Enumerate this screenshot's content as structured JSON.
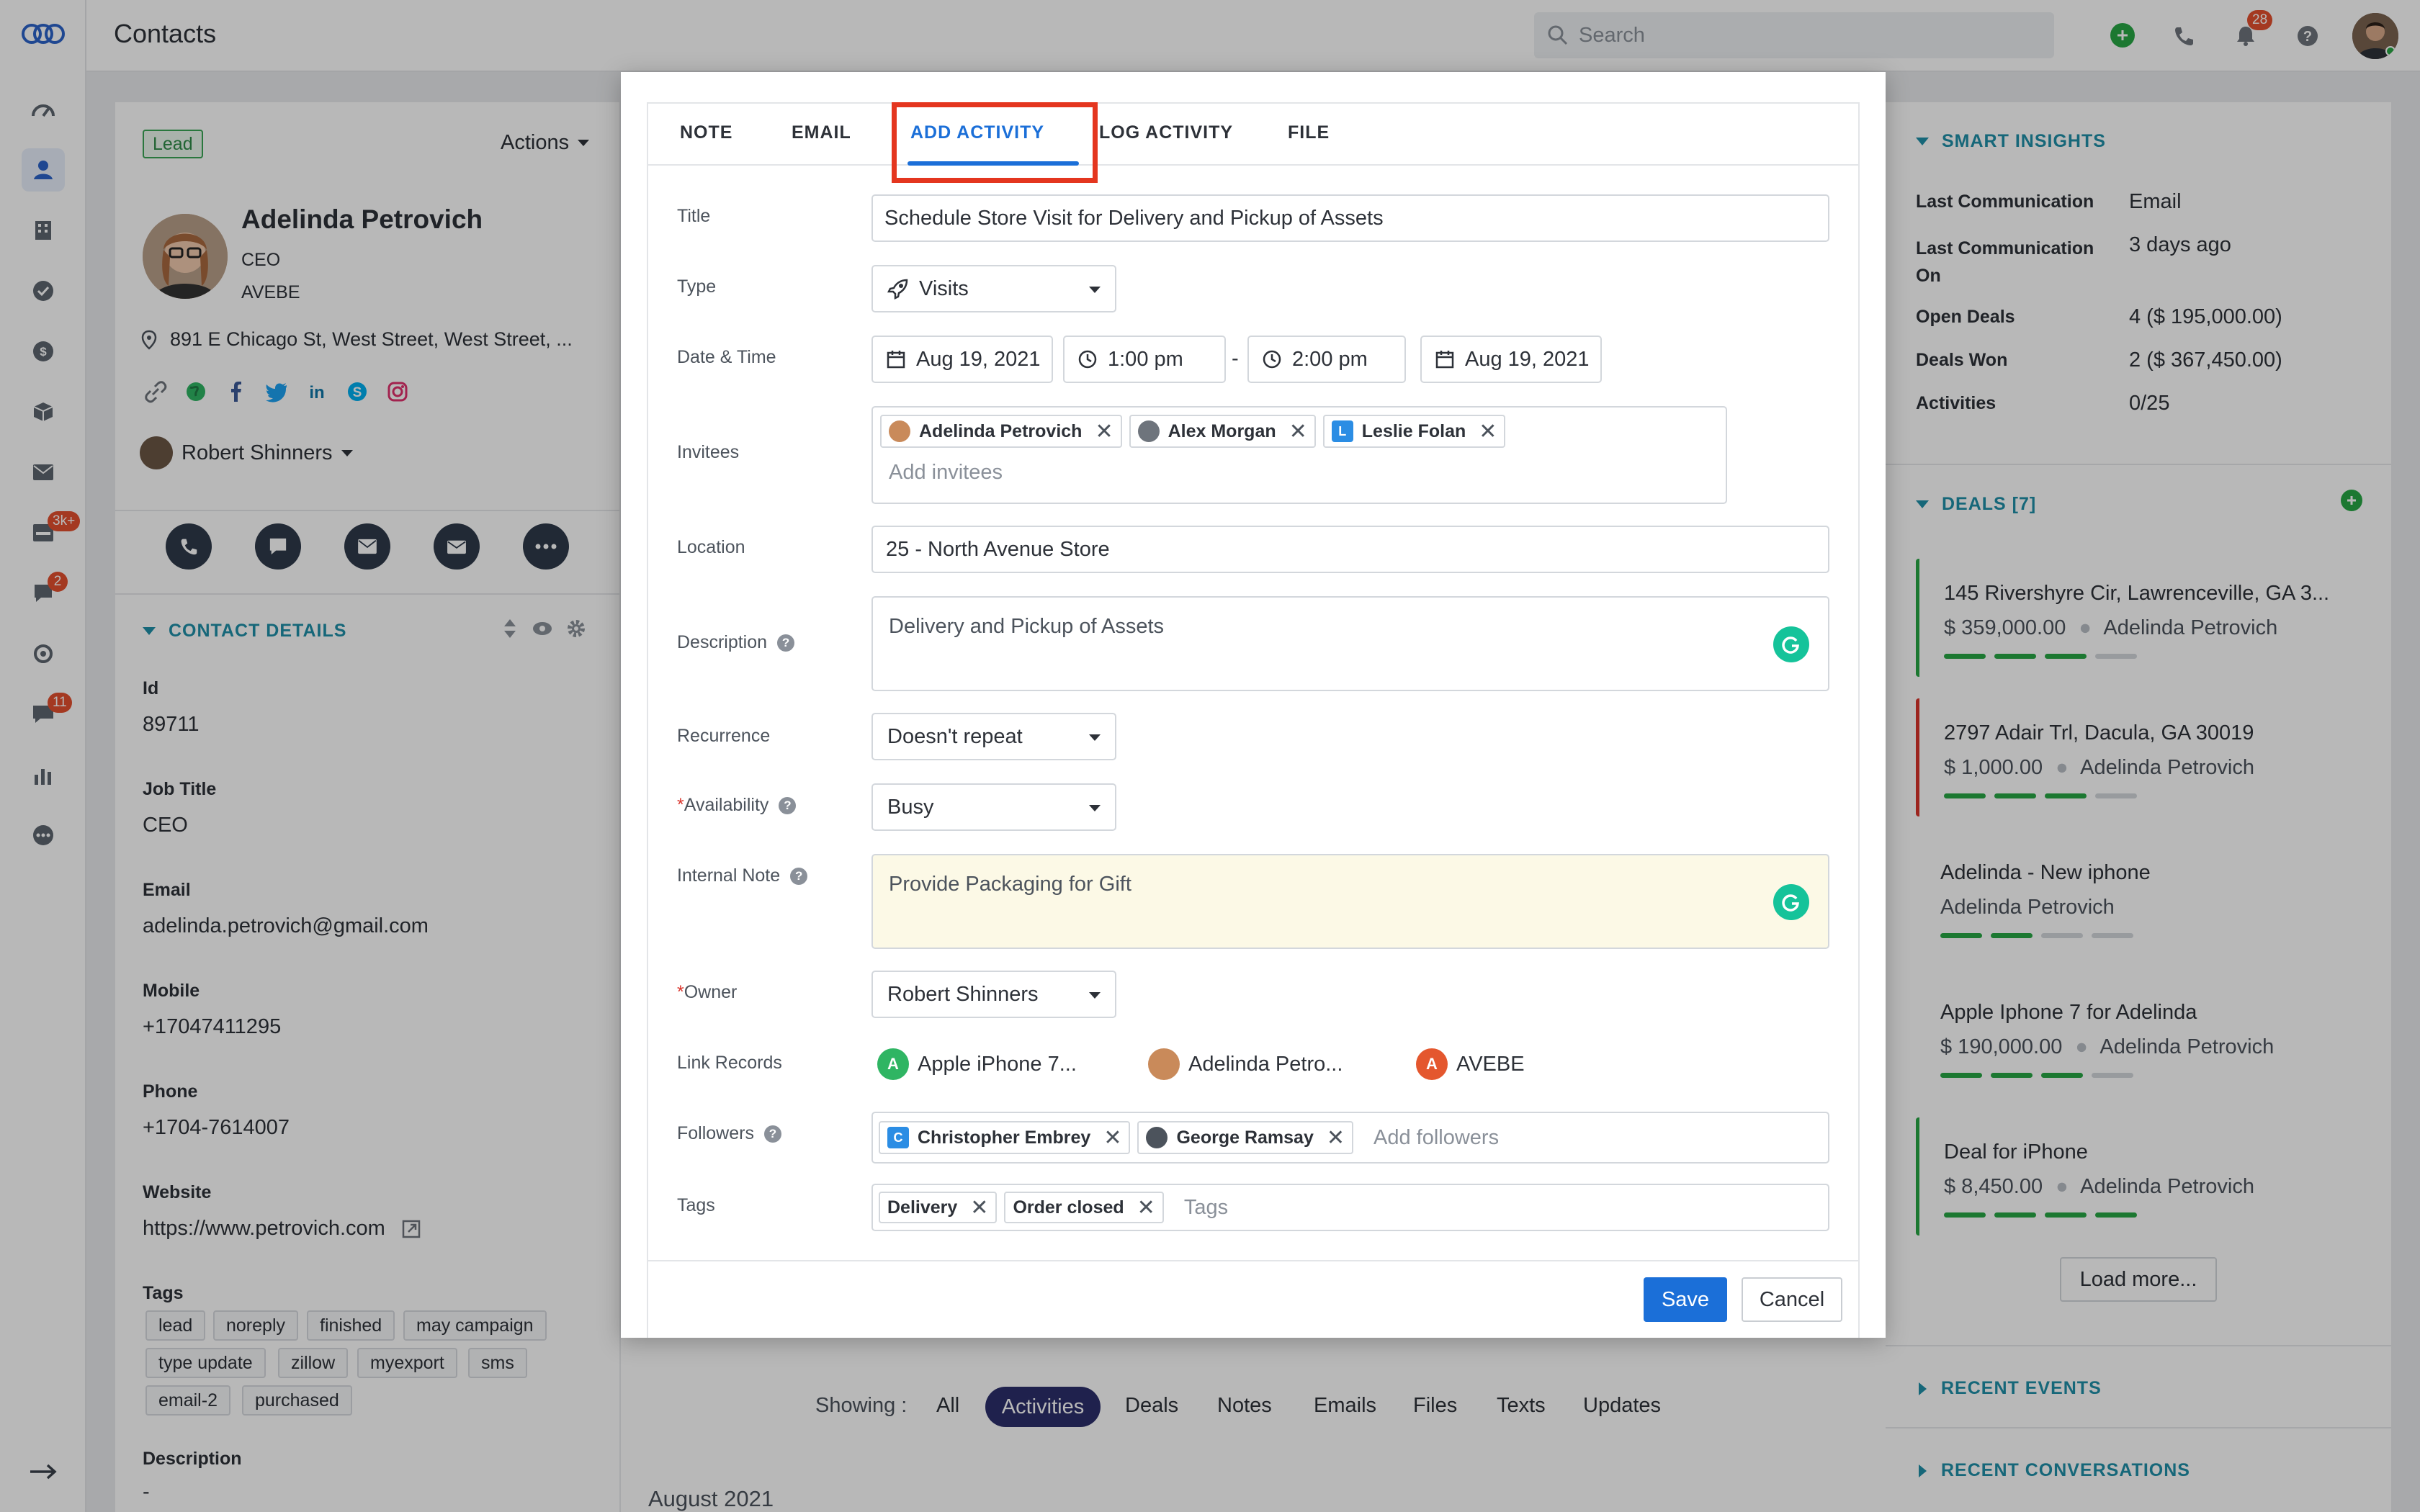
{
  "app": {
    "page_title": "Contacts"
  },
  "topbar": {
    "search_placeholder": "Search",
    "notification_count": "28"
  },
  "rail": {
    "badges": {
      "inbox": "3k+",
      "chat": "2",
      "messages": "11"
    }
  },
  "contact": {
    "lead_badge": "Lead",
    "actions_label": "Actions",
    "name": "Adelinda Petrovich",
    "title": "CEO",
    "company": "AVEBE",
    "address": "891 E Chicago St, West Street, West Street, ...",
    "owner": "Robert Shinners",
    "details_header": "CONTACT DETAILS",
    "fields": [
      {
        "label": "Id",
        "value": "89711"
      },
      {
        "label": "Job Title",
        "value": "CEO"
      },
      {
        "label": "Email",
        "value": "adelinda.petrovich@gmail.com"
      },
      {
        "label": "Mobile",
        "value": "+17047411295"
      },
      {
        "label": "Phone",
        "value": "+1704-7614007"
      },
      {
        "label": "Website",
        "value": "https://www.petrovich.com"
      }
    ],
    "tags_label": "Tags",
    "tags": [
      "lead",
      "noreply",
      "finished",
      "may campaign",
      "type update",
      "zillow",
      "myexport",
      "sms",
      "email-2",
      "purchased"
    ],
    "description_label": "Description",
    "description_value": "-"
  },
  "modal": {
    "tabs": [
      "NOTE",
      "EMAIL",
      "ADD ACTIVITY",
      "LOG ACTIVITY",
      "FILE"
    ],
    "active_tab": "ADD ACTIVITY",
    "labels": {
      "title": "Title",
      "type": "Type",
      "datetime": "Date & Time",
      "invitees": "Invitees",
      "location": "Location",
      "description": "Description",
      "recurrence": "Recurrence",
      "availability": "Availability",
      "internal_note": "Internal Note",
      "owner": "Owner",
      "link_records": "Link Records",
      "followers": "Followers",
      "tags": "Tags"
    },
    "title_value": "Schedule Store Visit for Delivery and Pickup of Assets",
    "type_value": "Visits",
    "start_date": "Aug 19, 2021",
    "start_time": "1:00 pm",
    "separator": "-",
    "end_time": "2:00 pm",
    "end_date": "Aug 19, 2021",
    "invitees": [
      {
        "name": "Adelinda Petrovich",
        "avatar": "photo"
      },
      {
        "name": "Alex Morgan",
        "avatar": "photo"
      },
      {
        "name": "Leslie Folan",
        "avatar": "L"
      }
    ],
    "invitees_placeholder": "Add invitees",
    "location_value": "25 - North Avenue Store",
    "description_value": "Delivery and Pickup of Assets",
    "recurrence_value": "Doesn't repeat",
    "availability_value": "Busy",
    "internal_note_value": "Provide Packaging for Gift",
    "owner_value": "Robert Shinners",
    "link_records": [
      {
        "name": "Apple iPhone 7...",
        "avatar": "A",
        "color": "#2fb563"
      },
      {
        "name": "Adelinda Petro...",
        "avatar": "photo",
        "color": "#c98a5a"
      },
      {
        "name": "AVEBE",
        "avatar": "A",
        "color": "#e4572e"
      }
    ],
    "followers": [
      {
        "name": "Christopher Embrey",
        "avatar": "C"
      },
      {
        "name": "George Ramsay",
        "avatar": "photo"
      }
    ],
    "followers_placeholder": "Add followers",
    "tags": [
      "Delivery",
      "Order closed"
    ],
    "tags_placeholder": "Tags",
    "save_label": "Save",
    "cancel_label": "Cancel",
    "required_mark": "*"
  },
  "timeline": {
    "showing_label": "Showing :",
    "filters": [
      "All",
      "Activities",
      "Deals",
      "Notes",
      "Emails",
      "Files",
      "Texts",
      "Updates"
    ],
    "active_filter": "Activities",
    "month": "August 2021"
  },
  "right_panel": {
    "smart_insights_header": "SMART INSIGHTS",
    "insights": [
      {
        "label": "Last Communication",
        "value": "Email"
      },
      {
        "label": "Last Communication On",
        "value": "3 days ago"
      },
      {
        "label": "Open Deals",
        "value": "4 ($ 195,000.00)"
      },
      {
        "label": "Deals Won",
        "value": "2 ($ 367,450.00)"
      },
      {
        "label": "Activities",
        "value": "0/25"
      }
    ],
    "deals_header": "DEALS [7]",
    "deals": [
      {
        "title": "145 Rivershyre Cir, Lawrenceville, GA 3...",
        "amount": "$ 359,000.00",
        "contact": "Adelinda Petrovich",
        "status_color": "#28a745",
        "progress": 3
      },
      {
        "title": "2797 Adair Trl, Dacula, GA 30019",
        "amount": "$ 1,000.00",
        "contact": "Adelinda Petrovich",
        "status_color": "#d9342b",
        "progress": 3
      },
      {
        "title": "Adelinda - New iphone",
        "amount": "",
        "contact": "Adelinda Petrovich",
        "status_color": "",
        "progress": 2
      },
      {
        "title": "Apple Iphone 7 for Adelinda",
        "amount": "$ 190,000.00",
        "contact": "Adelinda Petrovich",
        "status_color": "",
        "progress": 3
      },
      {
        "title": "Deal for iPhone",
        "amount": "$ 8,450.00",
        "contact": "Adelinda Petrovich",
        "status_color": "#28a745",
        "progress": 4
      }
    ],
    "load_more": "Load more...",
    "recent_events": "RECENT EVENTS",
    "recent_conversations": "RECENT CONVERSATIONS"
  },
  "colors": {
    "accent": "#1b6fd8",
    "teal": "#1f8fa8",
    "highlight_box": "#e4361f",
    "active_pill": "#2c2f6b"
  }
}
